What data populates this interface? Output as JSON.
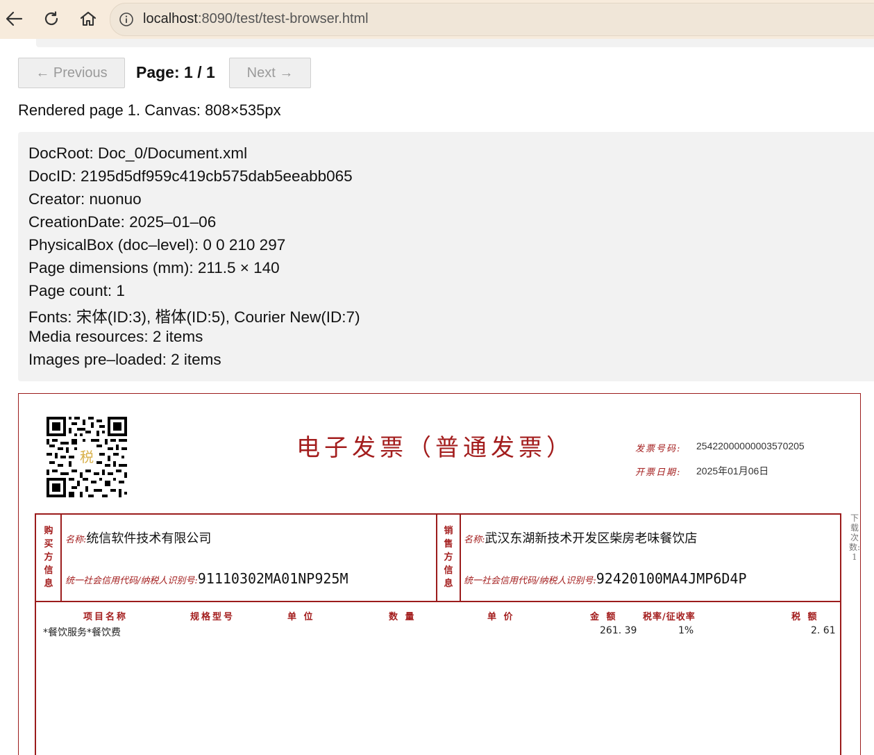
{
  "browser": {
    "url_host": "localhost",
    "url_rest": ":8090/test/test-browser.html"
  },
  "pager": {
    "prev_label": "← Previous",
    "page_label": "Page: 1 / 1",
    "next_label": "Next →"
  },
  "status": "Rendered page 1. Canvas: 808×535px",
  "info": [
    "DocRoot: Doc_0/Document.xml",
    "DocID: 2195d5df959c419cb575dab5eeabb065",
    "Creator: nuonuo",
    "CreationDate: 2025–01–06",
    "PhysicalBox (doc–level): 0 0 210 297",
    "Page dimensions (mm): 211.5 × 140",
    "Page count: 1",
    "Fonts: 宋体(ID:3), 楷体(ID:5), Courier New(ID:7)",
    "Media resources: 2 items",
    "Images pre–loaded: 2 items"
  ],
  "invoice": {
    "title": "电子发票（普通发票）",
    "number_label": "发票号码:",
    "number_value": "25422000000003570205",
    "date_label": "开票日期:",
    "date_value": "2025年01月06日",
    "buyer": {
      "side_label": "购买方信息",
      "name_label": "名称:",
      "name_value": "统信软件技术有限公司",
      "tax_label": "统一社会信用代码/纳税人识别号:",
      "tax_value": "91110302MA01NP925M"
    },
    "seller": {
      "side_label": "销售方信息",
      "name_label": "名称:",
      "name_value": "武汉东湖新技术开发区柴房老味餐饮店",
      "tax_label": "统一社会信用代码/纳税人识别号:",
      "tax_value": "92420100MA4JMP6D4P"
    },
    "columns": [
      "项目名称",
      "规格型号",
      "单 位",
      "数 量",
      "单 价",
      "金 额",
      "税率/征收率",
      "税 额"
    ],
    "items": [
      {
        "name": "*餐饮服务*餐饮费",
        "amount": "261. 39",
        "rate": "1%",
        "tax": "2. 61"
      }
    ],
    "side_note": "下载次数: 1"
  },
  "colors": {
    "invoice_red": "#a31d1d",
    "chrome_bg": "#f7ebdc"
  }
}
